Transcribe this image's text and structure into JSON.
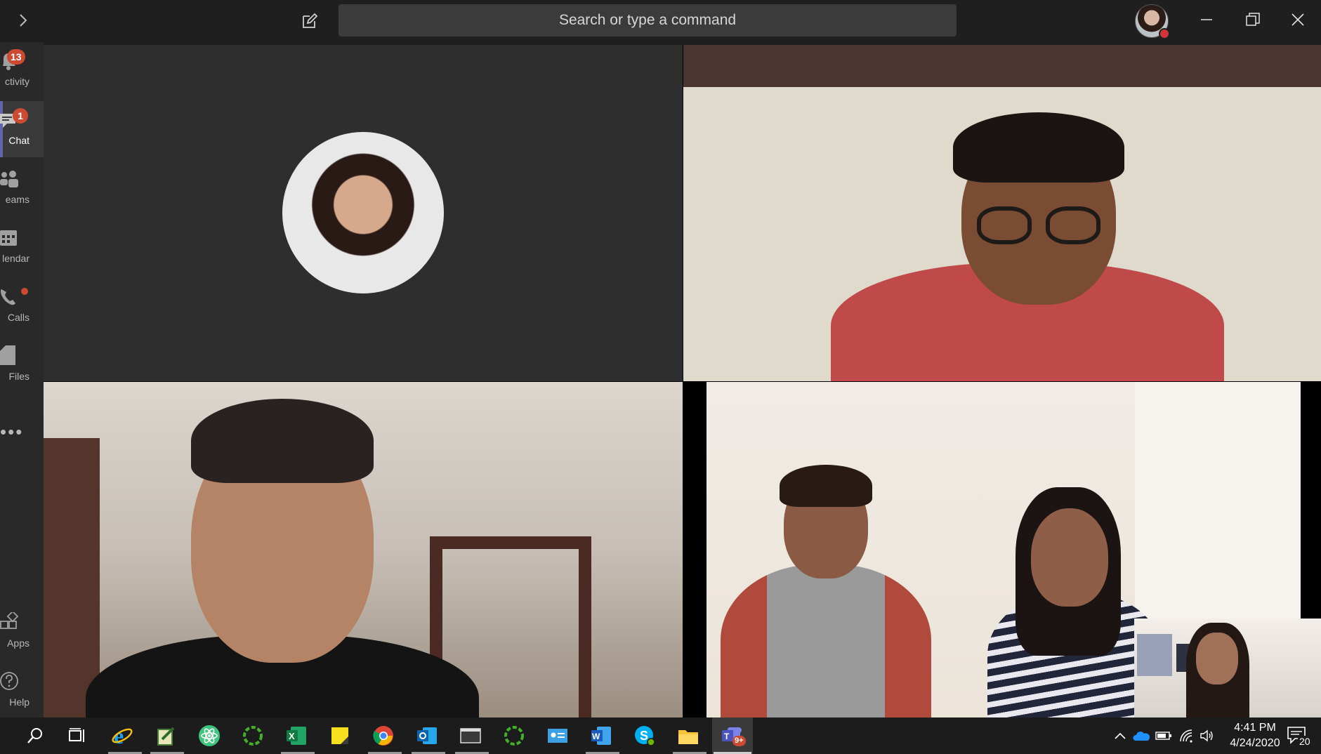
{
  "titlebar": {
    "search_placeholder": "Search or type a command"
  },
  "rail": {
    "items": [
      {
        "label": "Activity",
        "display": "ctivity",
        "badge": "13"
      },
      {
        "label": "Chat",
        "display": "Chat",
        "badge": "1"
      },
      {
        "label": "Teams",
        "display": "eams"
      },
      {
        "label": "Calendar",
        "display": "lendar"
      },
      {
        "label": "Calls",
        "display": "Calls",
        "dot": true
      },
      {
        "label": "Files",
        "display": "Files"
      },
      {
        "label": "More",
        "display": "•••"
      },
      {
        "label": "Apps",
        "display": "Apps"
      },
      {
        "label": "Help",
        "display": "Help"
      }
    ]
  },
  "meeting": {
    "participants": [
      "participant-1-avatar",
      "participant-2-video",
      "participant-3-video",
      "participant-4-video"
    ]
  },
  "taskbar": {
    "apps": [
      "search-icon",
      "task-view-icon",
      "internet-explorer-icon",
      "notepad-icon",
      "atom-icon",
      "loader-icon",
      "excel-icon",
      "sticky-notes-icon",
      "chrome-icon",
      "outlook-icon",
      "terminal-icon",
      "loader-icon",
      "contacts-icon",
      "word-icon",
      "skype-icon",
      "file-explorer-icon",
      "teams-icon"
    ],
    "teams_badge": "9+",
    "clock_time": "4:41 PM",
    "clock_date": "4/24/2020",
    "notification_count": "20"
  },
  "colors": {
    "accent": "#6264a7",
    "badge": "#cc4a31",
    "presence_busy": "#d13438"
  }
}
